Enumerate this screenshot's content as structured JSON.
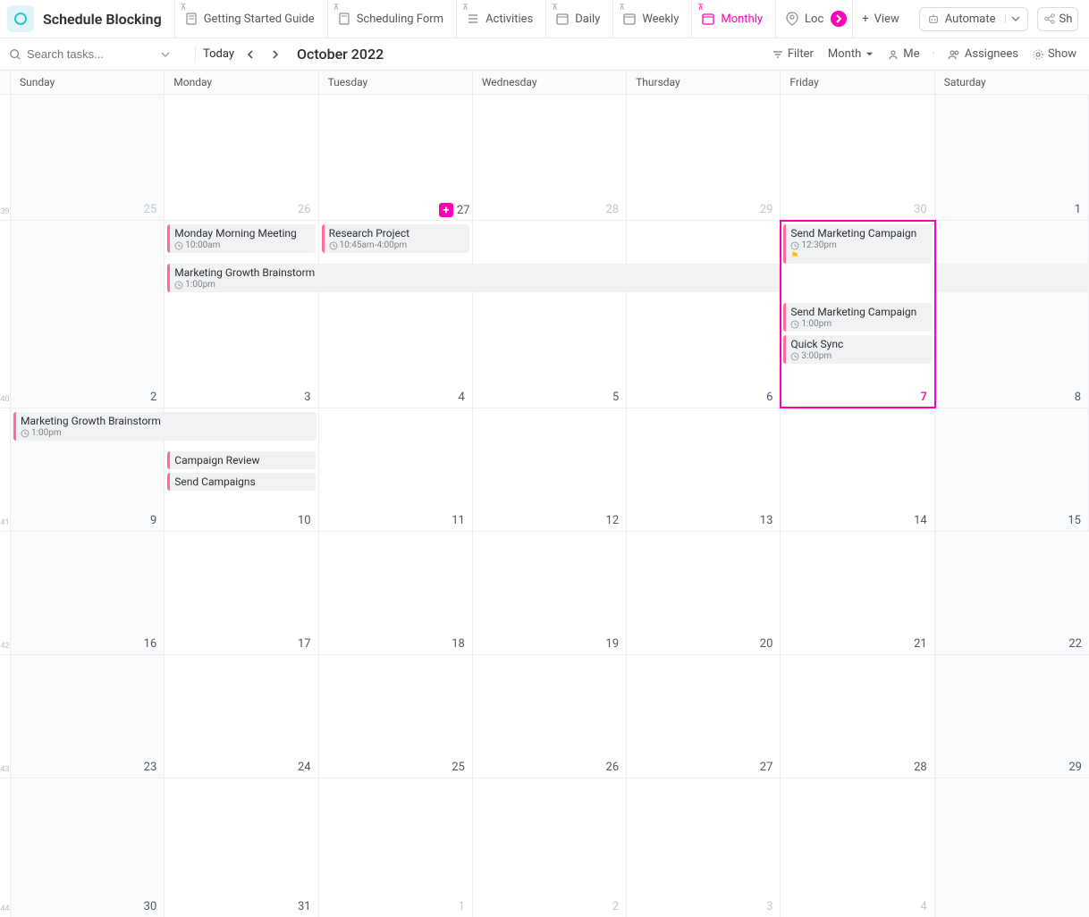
{
  "app": {
    "title": "Schedule Blocking"
  },
  "tabs": [
    {
      "label": "Getting Started Guide",
      "icon": "doc"
    },
    {
      "label": "Scheduling Form",
      "icon": "doc"
    },
    {
      "label": "Activities",
      "icon": "list"
    },
    {
      "label": "Daily",
      "icon": "cal"
    },
    {
      "label": "Weekly",
      "icon": "cal"
    },
    {
      "label": "Monthly",
      "icon": "cal",
      "active": true
    },
    {
      "label": "Loc",
      "icon": "pin"
    }
  ],
  "viewButton": "View",
  "automate": "Automate",
  "share": "Sh",
  "toolbar": {
    "searchPlaceholder": "Search tasks...",
    "today": "Today",
    "monthLabel": "October 2022",
    "filter": "Filter",
    "group": "Month",
    "me": "Me",
    "assignees": "Assignees",
    "show": "Show"
  },
  "dayHeaders": [
    "Sunday",
    "Monday",
    "Tuesday",
    "Wednesday",
    "Thursday",
    "Friday",
    "Saturday"
  ],
  "weekNumbers": [
    "39",
    "40",
    "41",
    "42",
    "43",
    "44"
  ],
  "grid": [
    [
      {
        "n": "",
        "other": false
      },
      {
        "n": "25",
        "other": true
      },
      {
        "n": "26",
        "other": true
      },
      {
        "n": "",
        "other": true,
        "addmark": true,
        "addnum": "27"
      },
      {
        "n": "28",
        "other": true
      },
      {
        "n": "29",
        "other": true
      },
      {
        "n": "30",
        "other": true
      },
      {
        "n": "1",
        "other": false
      }
    ],
    [
      {
        "n": "2"
      },
      {
        "n": "3"
      },
      {
        "n": "4"
      },
      {
        "n": "5"
      },
      {
        "n": "6"
      },
      {
        "n": "7",
        "today": true
      },
      {
        "n": "8"
      }
    ],
    [
      {
        "n": "9"
      },
      {
        "n": "10"
      },
      {
        "n": "11"
      },
      {
        "n": "12"
      },
      {
        "n": "13"
      },
      {
        "n": "14"
      },
      {
        "n": "15"
      }
    ],
    [
      {
        "n": "16"
      },
      {
        "n": "17"
      },
      {
        "n": "18"
      },
      {
        "n": "19"
      },
      {
        "n": "20"
      },
      {
        "n": "21"
      },
      {
        "n": "22"
      }
    ],
    [
      {
        "n": "23"
      },
      {
        "n": "24"
      },
      {
        "n": "25"
      },
      {
        "n": "26"
      },
      {
        "n": "27"
      },
      {
        "n": "28"
      },
      {
        "n": "29"
      }
    ],
    [
      {
        "n": "30"
      },
      {
        "n": "31"
      },
      {
        "n": "1",
        "other": true
      },
      {
        "n": "2",
        "other": true
      },
      {
        "n": "3",
        "other": true
      },
      {
        "n": "4",
        "other": true
      },
      {
        "n": "",
        "other": true
      }
    ]
  ],
  "events": {
    "w1_mon": [
      {
        "title": "Monday Morning Meeting",
        "time": "10:00am"
      }
    ],
    "w1_tue": [
      {
        "title": "Research Project",
        "time": "10:45am-4:00pm"
      }
    ],
    "w1_span": {
      "title": "Marketing Growth Brainstorm",
      "time": "1:00pm"
    },
    "w1_fri": [
      {
        "title": "Send Marketing Campaign",
        "time": "12:30pm",
        "flag": true
      },
      {
        "title": "Send Marketing Campaign",
        "time": "1:00pm"
      },
      {
        "title": "Quick Sync",
        "time": "3:00pm"
      }
    ],
    "w2_span": {
      "title": "Marketing Growth Brainstorm",
      "time": "1:00pm"
    },
    "w2_mon": [
      {
        "title": "Campaign Review"
      },
      {
        "title": "Send Campaigns"
      }
    ]
  }
}
